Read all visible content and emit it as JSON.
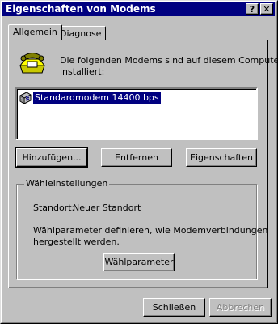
{
  "window": {
    "title": "Eigenschaften von Modems",
    "help_glyph": "?",
    "close_glyph": "✕"
  },
  "tabs": [
    {
      "label": "Allgemein"
    },
    {
      "label": "Diagnose"
    }
  ],
  "general": {
    "intro_line1": "Die folgenden Modems sind auf diesem Computer",
    "intro_line2": "installiert:",
    "modems": [
      {
        "name": "Standardmodem 14400 bps",
        "selected": true
      }
    ]
  },
  "buttons": {
    "add": "Hinzufügen...",
    "remove": "Entfernen",
    "properties": "Eigenschaften",
    "dial_params": "Wählparameter",
    "close": "Schließen",
    "cancel": "Abbrechen"
  },
  "dialing": {
    "group_label": "Wähleinstellungen",
    "location_label": "Standort:",
    "location_value": "Neuer Standort",
    "desc_line1": "Wählparameter definieren, wie Modemverbindungen",
    "desc_line2": "hergestellt werden."
  },
  "icons": {
    "phone": "phone-icon",
    "modem": "modem-icon"
  },
  "colors": {
    "titlebar": "#000080",
    "face": "#c0c0c0",
    "selection": "#000080"
  }
}
